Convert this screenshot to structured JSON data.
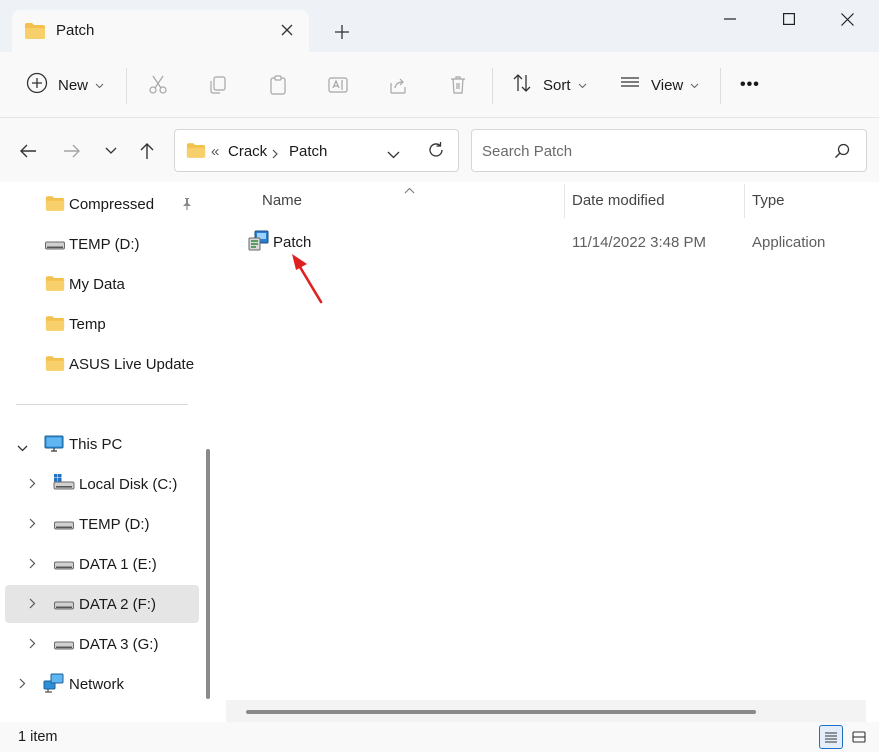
{
  "window": {
    "tab_title": "Patch",
    "new_tab_symbol": "+",
    "controls": [
      "minimize",
      "maximize",
      "close"
    ]
  },
  "toolbar": {
    "new_label": "New",
    "sort_label": "Sort",
    "view_label": "View",
    "more_label": "•••",
    "icons": [
      "plus-circle-icon",
      "cut-icon",
      "copy-icon",
      "paste-icon",
      "rename-icon",
      "share-icon",
      "delete-icon",
      "sort-icon",
      "view-icon"
    ]
  },
  "address": {
    "overflow": "«",
    "crumbs": [
      "Crack",
      "Patch"
    ],
    "search_placeholder": "Search Patch"
  },
  "nav": {
    "quick_access": [
      {
        "label": "Compressed",
        "icon": "folder-icon",
        "pinned": true
      },
      {
        "label": "TEMP (D:)",
        "icon": "drive-icon"
      },
      {
        "label": "My Data",
        "icon": "folder-icon"
      },
      {
        "label": "Temp",
        "icon": "folder-icon"
      },
      {
        "label": "ASUS Live Update",
        "icon": "folder-icon"
      }
    ],
    "this_pc": {
      "label": "This PC",
      "expanded": true
    },
    "drives": [
      {
        "label": "Local Disk (C:)",
        "icon": "windows-drive-icon"
      },
      {
        "label": "TEMP (D:)",
        "icon": "drive-icon"
      },
      {
        "label": "DATA 1 (E:)",
        "icon": "drive-icon"
      },
      {
        "label": "DATA 2 (F:)",
        "icon": "drive-icon",
        "selected": true
      },
      {
        "label": "DATA 3 (G:)",
        "icon": "drive-icon"
      }
    ],
    "network": {
      "label": "Network"
    }
  },
  "content": {
    "columns": {
      "name": "Name",
      "date": "Date modified",
      "type": "Type"
    },
    "files": [
      {
        "name": "Patch",
        "date_modified": "11/14/2022 3:48 PM",
        "type": "Application",
        "icon": "application-icon"
      }
    ]
  },
  "status": {
    "item_count": "1 item"
  },
  "colors": {
    "titlebar": "#eef1f6",
    "folder": "#f2c14e",
    "selection": "#e5e5e5",
    "annotation_arrow": "#e02020",
    "accent": "#1f6fc5"
  }
}
